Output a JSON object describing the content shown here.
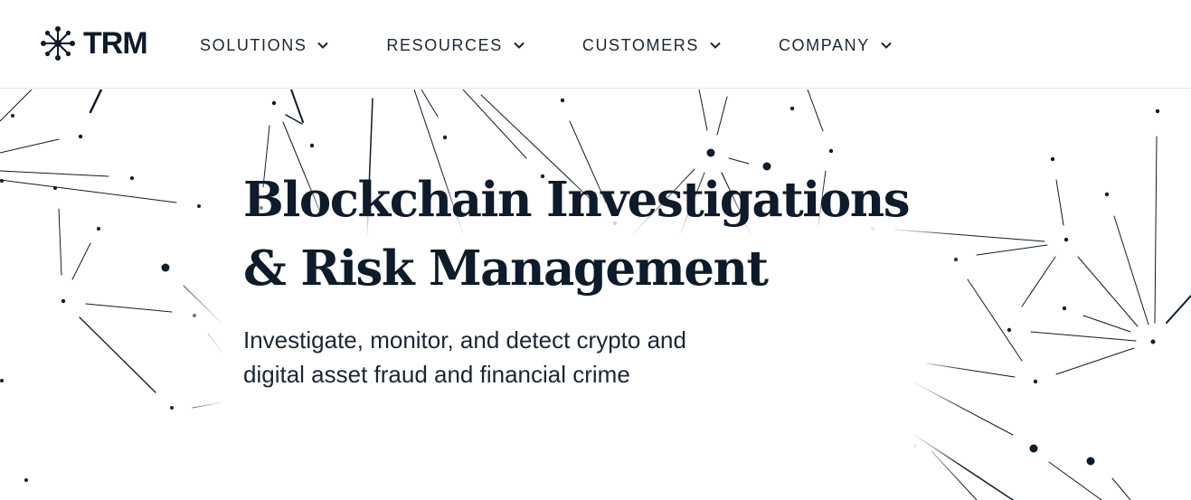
{
  "brand": {
    "name": "TRM",
    "logo_icon": "network-star-icon"
  },
  "nav": {
    "items": [
      {
        "label": "SOLUTIONS",
        "icon": "chevron-down-icon"
      },
      {
        "label": "RESOURCES",
        "icon": "chevron-down-icon"
      },
      {
        "label": "CUSTOMERS",
        "icon": "chevron-down-icon"
      },
      {
        "label": "COMPANY",
        "icon": "chevron-down-icon"
      }
    ]
  },
  "hero": {
    "title_line1": "Blockchain Investigations",
    "title_line2": "& Risk Management",
    "subtitle_line1": "Investigate, monitor, and detect crypto and",
    "subtitle_line2": "digital asset fraud and financial crime",
    "background": "network-graph-illustration"
  },
  "colors": {
    "ink": "#0d1b2a",
    "text": "#1a2633",
    "background": "#ffffff"
  }
}
